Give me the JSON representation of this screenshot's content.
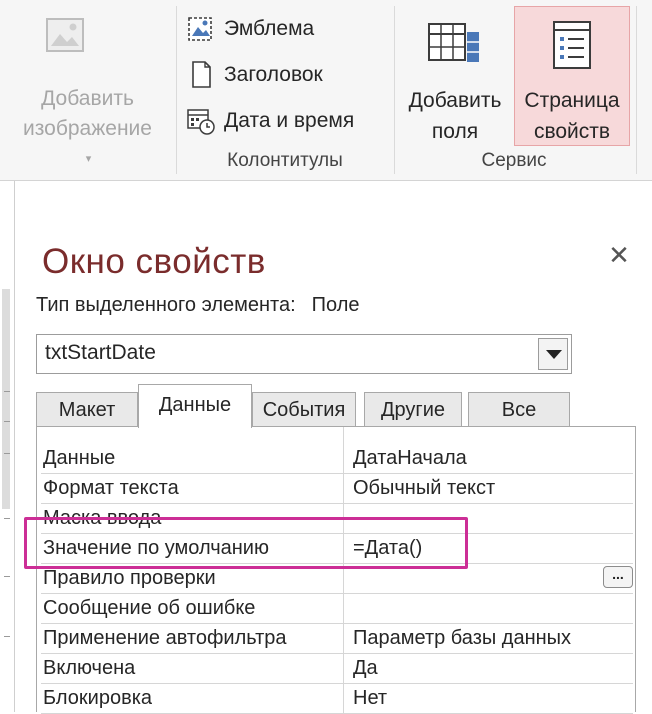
{
  "ribbon": {
    "add_image": {
      "line1": "Добавить",
      "line2": "изображение",
      "icon": "image-icon"
    },
    "header_footer": {
      "items": [
        {
          "label": "Эмблема",
          "icon": "logo-icon"
        },
        {
          "label": "Заголовок",
          "icon": "title-icon"
        },
        {
          "label": "Дата и время",
          "icon": "date-time-icon"
        }
      ],
      "group_label": "Колонтитулы"
    },
    "tools": {
      "add_fields": {
        "line1": "Добавить",
        "line2": "поля",
        "icon": "add-fields-icon"
      },
      "property_sheet": {
        "line1": "Страница",
        "line2": "свойств",
        "icon": "property-sheet-icon",
        "active": true
      },
      "group_label": "Сервис"
    }
  },
  "pane": {
    "title": "Окно свойств",
    "selection_type_label": "Тип выделенного элемента:",
    "selection_type_value": "Поле",
    "selected_control": "txtStartDate",
    "tabs": [
      "Макет",
      "Данные",
      "События",
      "Другие",
      "Все"
    ],
    "active_tab": "Данные",
    "properties": [
      {
        "name": "Данные",
        "value": "ДатаНачала"
      },
      {
        "name": "Формат текста",
        "value": "Обычный текст"
      },
      {
        "name": "Маска ввода",
        "value": ""
      },
      {
        "name": "Значение по умолчанию",
        "value": "=Дата()"
      },
      {
        "name": "Правило проверки",
        "value": ""
      },
      {
        "name": "Сообщение об ошибке",
        "value": ""
      },
      {
        "name": "Применение автофильтра",
        "value": "Параметр базы данных"
      },
      {
        "name": "Включена",
        "value": "Да"
      },
      {
        "name": "Блокировка",
        "value": "Нет"
      }
    ],
    "builder_button": "...",
    "highlighted_property": "Значение по умолчанию"
  },
  "colors": {
    "title": "#7a2c2c",
    "highlight": "#cc2e96",
    "active_button_bg": "#f7d9da"
  }
}
